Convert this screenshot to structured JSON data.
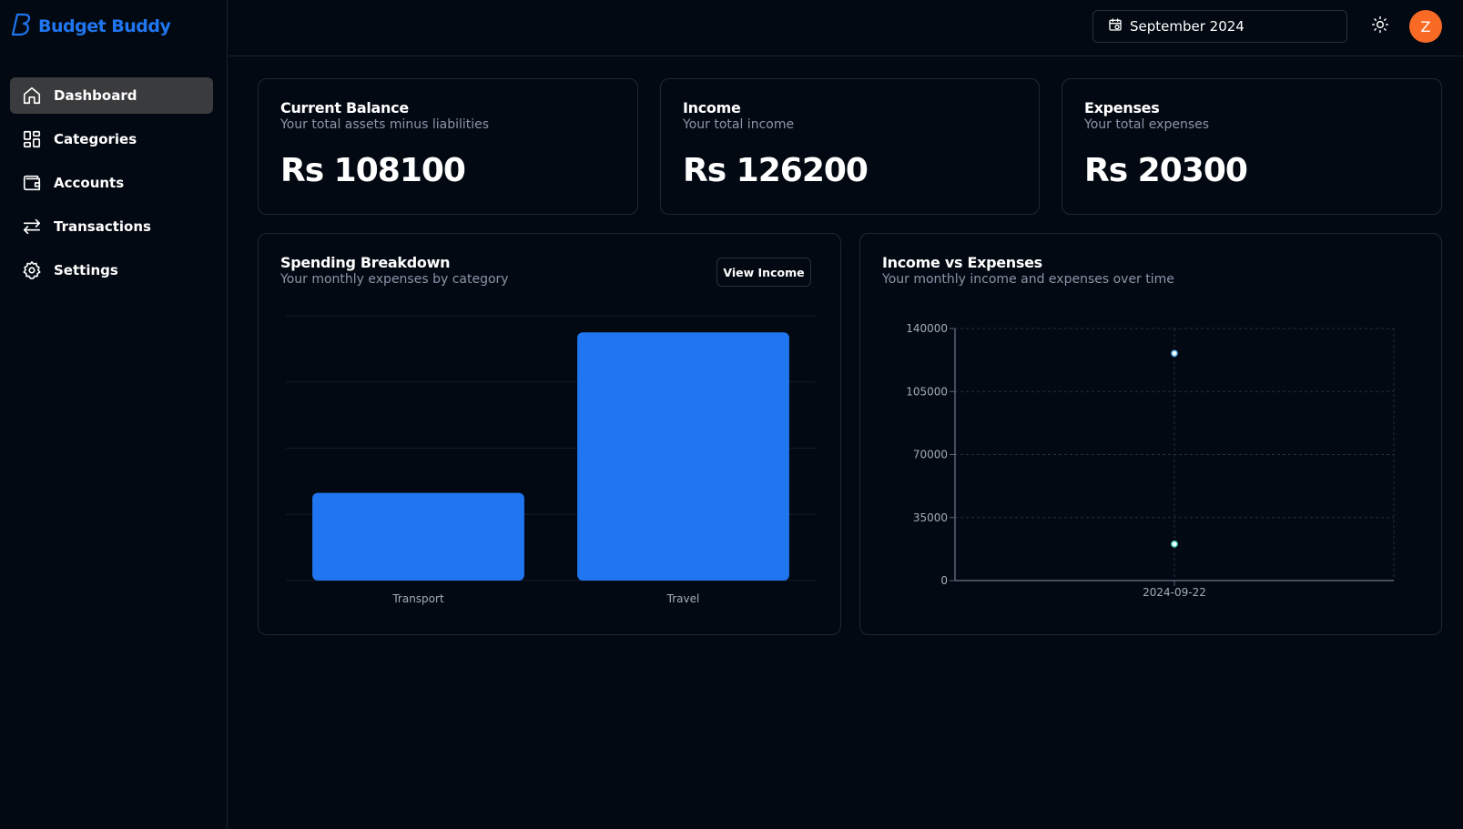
{
  "app": {
    "name": "Budget Buddy"
  },
  "sidebar": {
    "items": [
      {
        "label": "Dashboard",
        "icon": "home-icon",
        "active": true
      },
      {
        "label": "Categories",
        "icon": "grid-icon",
        "active": false
      },
      {
        "label": "Accounts",
        "icon": "wallet-icon",
        "active": false
      },
      {
        "label": "Transactions",
        "icon": "arrows-icon",
        "active": false
      },
      {
        "label": "Settings",
        "icon": "gear-icon",
        "active": false
      }
    ]
  },
  "header": {
    "date_range": "September 2024",
    "theme_icon": "sun-icon",
    "avatar_initial": "Z"
  },
  "summary": {
    "balance": {
      "title": "Current Balance",
      "subtitle": "Your total assets minus liabilities",
      "value": "Rs 108100"
    },
    "income": {
      "title": "Income",
      "subtitle": "Your total income",
      "value": "Rs 126200"
    },
    "expenses": {
      "title": "Expenses",
      "subtitle": "Your total expenses",
      "value": "Rs 20300"
    }
  },
  "spending": {
    "title": "Spending Breakdown",
    "subtitle": "Your monthly expenses by category",
    "button_label": "View Income"
  },
  "income_vs_expenses": {
    "title": "Income vs Expenses",
    "subtitle": "Your monthly income and expenses over time"
  },
  "colors": {
    "accent": "#1f76f0",
    "avatar": "#f96a25",
    "background": "#030912",
    "income_point": "#5fb7f2",
    "expense_point": "#5de0c6"
  },
  "chart_data": [
    {
      "type": "bar",
      "categories": [
        "Transport",
        "Travel"
      ],
      "values": [
        5300,
        15000
      ],
      "ylim": [
        0,
        16000
      ],
      "grid": true,
      "title": "",
      "xlabel": "",
      "ylabel": ""
    },
    {
      "type": "scatter",
      "x": [
        "2024-09-22"
      ],
      "series": [
        {
          "values": [
            126200
          ]
        },
        {
          "values": [
            20300
          ]
        }
      ],
      "yticks": [
        0,
        35000,
        70000,
        105000,
        140000
      ],
      "ylim": [
        0,
        140000
      ],
      "grid": true,
      "title": "",
      "xlabel": "",
      "ylabel": ""
    }
  ]
}
